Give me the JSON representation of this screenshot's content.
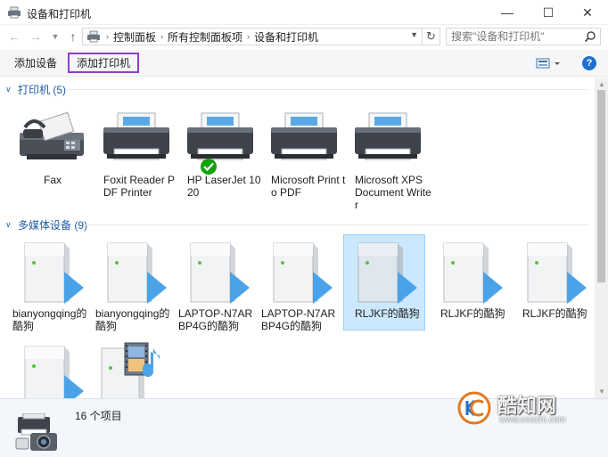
{
  "window": {
    "title": "设备和打印机",
    "minimize_glyph": "—",
    "maximize_glyph": "☐",
    "close_glyph": "✕"
  },
  "nav": {
    "back_glyph": "←",
    "forward_glyph": "→",
    "up_glyph": "↑",
    "breadcrumb": [
      "控制面板",
      "所有控制面板项",
      "设备和打印机"
    ],
    "refresh_glyph": "↻"
  },
  "search": {
    "placeholder": "搜索\"设备和打印机\""
  },
  "toolbar": {
    "add_device_label": "添加设备",
    "add_printer_label": "添加打印机",
    "help_label": "?"
  },
  "groups": {
    "printers": {
      "title": "打印机 (5)",
      "items": [
        {
          "label": "Fax",
          "icon": "fax-icon"
        },
        {
          "label": "Foxit Reader PDF Printer",
          "icon": "printer-icon"
        },
        {
          "label": "HP LaserJet 1020",
          "icon": "printer-icon",
          "default": true
        },
        {
          "label": "Microsoft Print to PDF",
          "icon": "printer-icon"
        },
        {
          "label": "Microsoft XPS Document Writer",
          "icon": "printer-icon"
        }
      ]
    },
    "multimedia": {
      "title": "多媒体设备 (9)",
      "items": [
        {
          "label": "bianyongqing的酷狗",
          "icon": "media-server-icon"
        },
        {
          "label": "bianyongqing的酷狗",
          "icon": "media-server-icon"
        },
        {
          "label": "LAPTOP-N7ARBP4G的酷狗",
          "icon": "media-server-icon"
        },
        {
          "label": "LAPTOP-N7ARBP4G的酷狗",
          "icon": "media-server-icon"
        },
        {
          "label": "RLJKF的酷狗",
          "icon": "media-server-icon",
          "selected": true
        },
        {
          "label": "RLJKF的酷狗",
          "icon": "media-server-icon"
        },
        {
          "label": "RLJKF的酷狗",
          "icon": "media-server-icon"
        },
        {
          "label": "",
          "icon": "media-server-icon"
        },
        {
          "label": "",
          "icon": "media-player-icon"
        }
      ]
    }
  },
  "status": {
    "count_text": "16 个项目"
  },
  "watermark": {
    "name": "酷知网",
    "url": "www.coozhi.com"
  },
  "colors": {
    "accent_purple": "#8e3fc4",
    "group_title_blue": "#1e5ea8",
    "selection_bg": "#cce8ff",
    "check_green": "#13a10e",
    "media_arrow_blue": "#4aa3e8"
  }
}
